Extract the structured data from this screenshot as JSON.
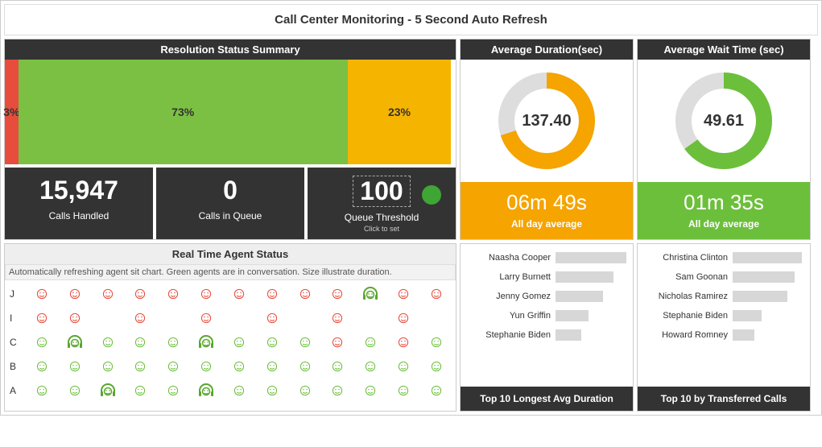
{
  "page_title": "Call Center Monitoring - 5 Second Auto Refresh",
  "resolution": {
    "title": "Resolution Status Summary",
    "segments": [
      {
        "pct": 3,
        "color": "red",
        "label": "3%"
      },
      {
        "pct": 73,
        "color": "green",
        "label": "73%"
      },
      {
        "pct": 23,
        "color": "orange",
        "label": "23%"
      }
    ],
    "metrics": {
      "calls_handled": {
        "value": "15,947",
        "label": "Calls Handled"
      },
      "calls_in_queue": {
        "value": "0",
        "label": "Calls in Queue"
      },
      "queue_threshold": {
        "value": "100",
        "label": "Queue Threshold",
        "sublabel": "Click to set"
      }
    }
  },
  "avg_duration": {
    "title": "Average Duration(sec)",
    "center": "137.40",
    "pct": 70,
    "footer_big": "06m 49s",
    "footer_small": "All day average"
  },
  "avg_wait": {
    "title": "Average Wait Time (sec)",
    "center": "49.61",
    "pct": 65,
    "footer_big": "01m 35s",
    "footer_small": "All day average"
  },
  "agents": {
    "title": "Real Time Agent Status",
    "note": "Automatically refreshing agent sit chart. Green agents are in conversation. Size illustrate duration.",
    "rows": [
      "J",
      "I",
      "C",
      "B",
      "A"
    ],
    "cells": {
      "J": [
        "r",
        "r",
        "r",
        "r",
        "r",
        "r",
        "r",
        "r",
        "r",
        "r",
        "G",
        "r",
        "r"
      ],
      "I": [
        "r",
        "r",
        "",
        "r",
        "",
        "r",
        "",
        "r",
        "",
        "r",
        "",
        "r",
        ""
      ],
      "C": [
        "g",
        "G",
        "g",
        "g",
        "g",
        "G",
        "g",
        "g",
        "g",
        "r",
        "g",
        "r",
        "g"
      ],
      "B": [
        "g",
        "g",
        "g",
        "g",
        "g",
        "g",
        "g",
        "g",
        "g",
        "g",
        "g",
        "g",
        "g"
      ],
      "A": [
        "g",
        "g",
        "G",
        "g",
        "g",
        "G",
        "g",
        "g",
        "g",
        "g",
        "g",
        "g",
        "g"
      ]
    }
  },
  "top_duration": {
    "footer": "Top 10 Longest Avg Duration",
    "rows": [
      {
        "name": "Naasha Cooper",
        "pct": 100
      },
      {
        "name": "Larry Burnett",
        "pct": 80
      },
      {
        "name": "Jenny Gomez",
        "pct": 65
      },
      {
        "name": "Yun Griffin",
        "pct": 45
      },
      {
        "name": "Stephanie Biden",
        "pct": 35
      }
    ]
  },
  "top_transferred": {
    "footer": "Top 10 by Transferred Calls",
    "rows": [
      {
        "name": "Christina Clinton",
        "pct": 95
      },
      {
        "name": "Sam Goonan",
        "pct": 85
      },
      {
        "name": "Nicholas Ramirez",
        "pct": 75
      },
      {
        "name": "Stephanie Biden",
        "pct": 40
      },
      {
        "name": "Howard Romney",
        "pct": 30
      }
    ]
  },
  "chart_data": [
    {
      "type": "bar",
      "orientation": "stacked-horizontal",
      "title": "Resolution Status Summary",
      "categories": [
        "red",
        "green",
        "orange"
      ],
      "values": [
        3,
        73,
        23
      ],
      "unit": "%"
    },
    {
      "type": "pie",
      "title": "Average Duration(sec)",
      "values": [
        70,
        30
      ],
      "center_value": 137.4,
      "footer": "06m 49s"
    },
    {
      "type": "pie",
      "title": "Average Wait Time (sec)",
      "values": [
        65,
        35
      ],
      "center_value": 49.61,
      "footer": "01m 35s"
    },
    {
      "type": "bar",
      "orientation": "horizontal",
      "title": "Top 10 Longest Avg Duration",
      "categories": [
        "Naasha Cooper",
        "Larry Burnett",
        "Jenny Gomez",
        "Yun Griffin",
        "Stephanie Biden"
      ],
      "values": [
        100,
        80,
        65,
        45,
        35
      ]
    },
    {
      "type": "bar",
      "orientation": "horizontal",
      "title": "Top 10 by Transferred Calls",
      "categories": [
        "Christina Clinton",
        "Sam Goonan",
        "Nicholas Ramirez",
        "Stephanie Biden",
        "Howard Romney"
      ],
      "values": [
        95,
        85,
        75,
        40,
        30
      ]
    }
  ]
}
